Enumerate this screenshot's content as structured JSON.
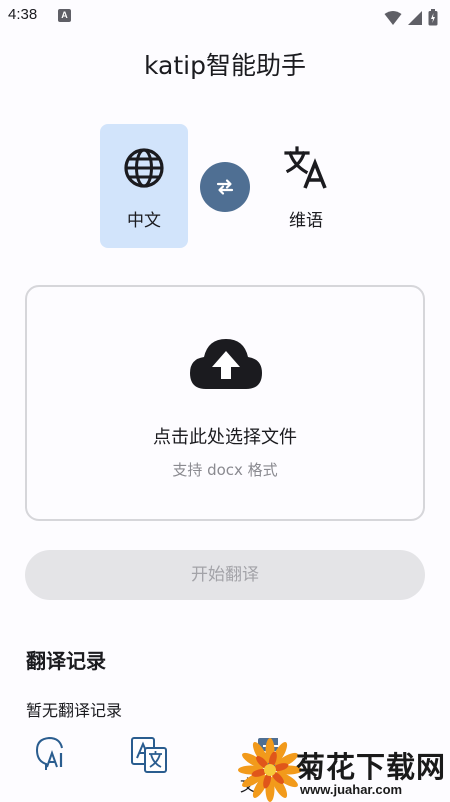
{
  "status_bar": {
    "time": "4:38",
    "notification_badge": "A",
    "icons": [
      "wifi-icon",
      "signal-icon",
      "battery-icon"
    ]
  },
  "app": {
    "title": "katip智能助手"
  },
  "languages": {
    "source": {
      "label": "中文",
      "icon": "globe-icon"
    },
    "target": {
      "label": "维语",
      "icon": "translate-icon"
    },
    "swap_icon": "swap-arrows-icon"
  },
  "upload": {
    "icon": "cloud-upload-icon",
    "title": "点击此处选择文件",
    "hint": "支持 docx 格式"
  },
  "start_button": {
    "label": "开始翻译"
  },
  "history": {
    "heading": "翻译记录",
    "empty_text": "暂无翻译记录"
  },
  "bottom_nav": {
    "items": [
      {
        "icon": "ai-head-icon"
      },
      {
        "icon": "translate-doc-icon"
      },
      {
        "icon": "document-icon",
        "label": "文"
      }
    ]
  },
  "watermark": {
    "text": "菊花下载网",
    "url": "www.juahar.com"
  },
  "colors": {
    "selected_lang_bg": "#d2e4fb",
    "swap_button": "#4f6f93",
    "disabled_button_bg": "#e4e4e7",
    "disabled_button_text": "#a3a3a8"
  }
}
